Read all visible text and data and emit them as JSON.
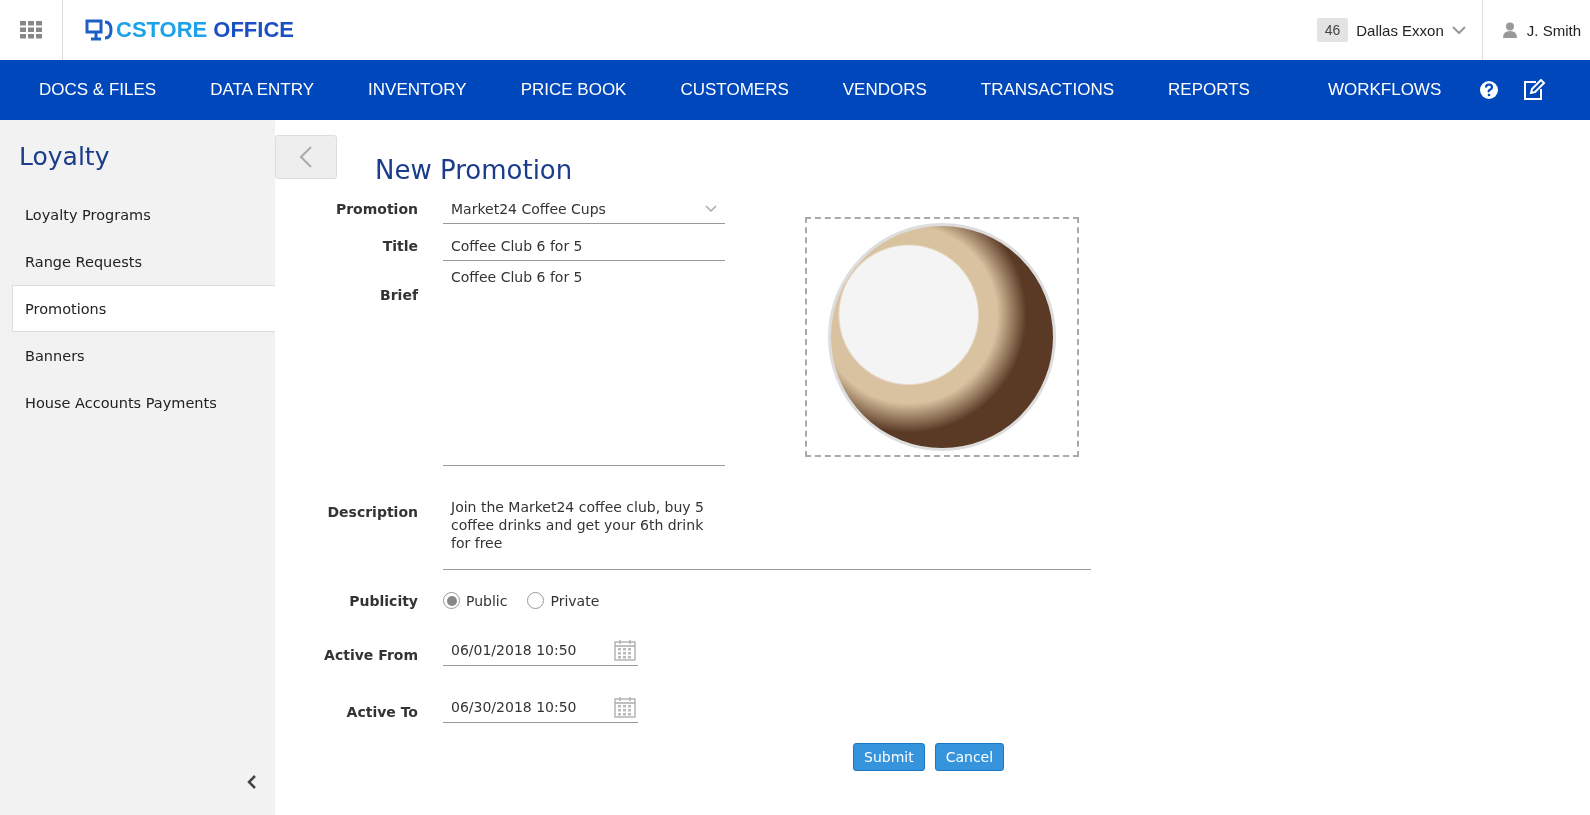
{
  "header": {
    "logo": {
      "part_1": "CSTORE",
      "part_2": "OFFICE"
    },
    "store": {
      "number": "46",
      "name": "Dallas Exxon"
    },
    "user": "J. Smith"
  },
  "nav": {
    "items": [
      "DOCS & FILES",
      "DATA ENTRY",
      "INVENTORY",
      "PRICE BOOK",
      "CUSTOMERS",
      "VENDORS",
      "TRANSACTIONS",
      "REPORTS",
      "WORKFLOWS"
    ]
  },
  "sidebar": {
    "title": "Loyalty",
    "items": [
      {
        "label": "Loyalty Programs",
        "selected": false
      },
      {
        "label": "Range Requests",
        "selected": false
      },
      {
        "label": "Promotions",
        "selected": true
      },
      {
        "label": "Banners",
        "selected": false
      },
      {
        "label": "House Accounts Payments",
        "selected": false
      }
    ]
  },
  "form": {
    "title": "New Promotion",
    "promotion": {
      "label": "Promotion",
      "value": "Market24 Coffee Cups"
    },
    "title_field": {
      "label": "Title",
      "value": "Coffee Club 6 for 5"
    },
    "brief": {
      "label": "Brief",
      "value": "Coffee Club 6 for 5"
    },
    "description": {
      "label": "Description",
      "value": "Join the Market24 coffee club, buy 5 coffee drinks and get your 6th drink for free"
    },
    "publicity": {
      "label": "Publicity",
      "options": [
        {
          "label": "Public",
          "selected": true
        },
        {
          "label": "Private",
          "selected": false
        }
      ]
    },
    "active_from": {
      "label": "Active From",
      "value": "06/01/2018 10:50"
    },
    "active_to": {
      "label": "Active To",
      "value": "06/30/2018 10:50"
    },
    "buttons": [
      "Submit",
      "Cancel"
    ]
  }
}
